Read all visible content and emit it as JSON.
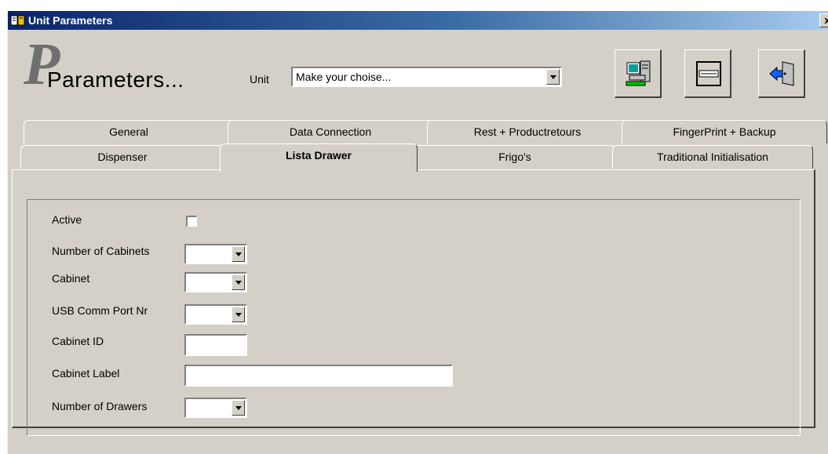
{
  "window": {
    "title": "Unit Parameters",
    "close": "x"
  },
  "header": {
    "logo_letter": "P",
    "logo_text": "Parameters...",
    "unit_label": "Unit",
    "unit_value": "Make your choise..."
  },
  "toolbar": {
    "buttons": [
      {
        "icon": "computer-network-icon"
      },
      {
        "icon": "window-list-icon"
      },
      {
        "icon": "exit-door-icon"
      }
    ]
  },
  "tabs": {
    "row_back": [
      "General",
      "Data Connection",
      "Rest + Productretours",
      "FingerPrint + Backup"
    ],
    "row_front": [
      "Dispenser",
      "Lista Drawer",
      "Frigo's",
      "Traditional Initialisation"
    ],
    "selected": "Lista Drawer"
  },
  "form": {
    "active_label": "Active",
    "num_cabinets_label": "Number of Cabinets",
    "cabinet_label": "Cabinet",
    "usb_port_label": "USB Comm Port Nr",
    "cabinet_id_label": "Cabinet ID",
    "cabinet_label_label": "Cabinet Label",
    "num_drawers_label": "Number of Drawers",
    "active_checked": false
  }
}
